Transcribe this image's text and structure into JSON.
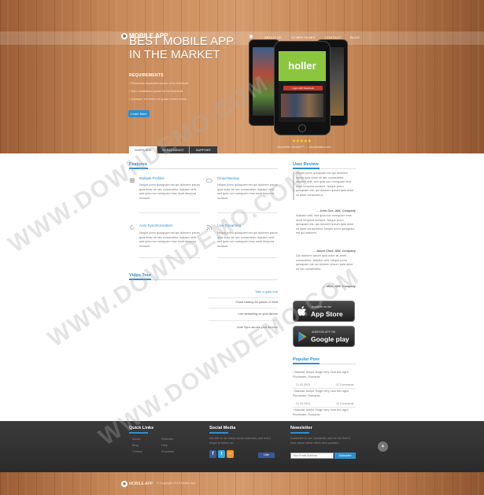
{
  "header": {
    "logo_text": "MOBILE APP",
    "nav": [
      "ABOUT US",
      "OTHER PAGES",
      "CONTACT",
      "BLOG"
    ]
  },
  "hero": {
    "title_line1": "BEST MOBILE APP",
    "title_line2": "IN THE MARKET",
    "requirements_heading": "REQUIREMENTS",
    "requirements": [
      "Phasellus imperdiet ipsum nunc tincidunt",
      "Sed vestibulum quam lorem tincidunt",
      "Quisque vel lorem ut quam ornare nunc"
    ],
    "learn_more": "Learn More",
    "phone_brand": "holler",
    "phone_button": "Login with Facebook",
    "rating": "★★★★★",
    "caption": "Abodeflex Mobile™ — Mobilelabs.com",
    "tabs": [
      "OVERVIEW",
      "SCREENSHOT",
      "SUPPORT"
    ]
  },
  "features": {
    "title": "Features",
    "items": [
      {
        "title": "Multiple Profiles",
        "text": "Neque porro quisquam est qui dolorem ipsum quia dolor sit nec consectetur, adipisci velit, sed quia non numquam eius modi tempora incidunt."
      },
      {
        "title": "Cloud Backup",
        "text": "Neque porro quisquam est qui dolorem ipsum quia dolor sit nec consectetur, adipisci velit, sed quia non numquam eius modi tempora incidunt."
      },
      {
        "title": "Auto Synchronization",
        "text": "Neque porro quisquam est qui dolorem ipsum quia dolor sit nec consectetur, adipisci velit, sed quia non numquam eius modi tempora incidunt."
      },
      {
        "title": "Live Streaming",
        "text": "Neque porro quisquam est qui dolorem ipsum quia dolor sit nec consectetur, adipisci velit, sed quia non numquam eius modi tempora incidunt."
      }
    ]
  },
  "video_tour": {
    "title": "Video Tour",
    "items": [
      "Take a quick tour",
      "Cloud backup for peace of mind",
      "Live streaming on your device",
      "Auto Sync across your devices"
    ]
  },
  "reviews": {
    "title": "User Review",
    "items": [
      {
        "text": "Neque porro quisquam est qui dolorem ipsum quia dolor sit nec consectetur, adipisci velit, sed quia non numquam eius modi tempora incidunt. Neque porro quisquam est, qui dolorem ipsum quia dolor sit amet consectetur.",
        "author": "— John Doe, ABC Company"
      },
      {
        "text": "Adipisci velit, sed quia non numquam eius modi tempora incidunt. Neque porro quisquam est, qui dolorem ipsum quia dolor sit amet consectetur. Neque porro quisquam est qui dolorem.",
        "author": "— Jason Clark, ABC Company"
      },
      {
        "text": "Qui dolorem ipsum quia dolor sit amet consectetur, adipisci velit. Neque porro quisquam est qui dolorem ipsum quia dolor sit nec consectetur.",
        "author": "— Mike, ABC Company"
      }
    ]
  },
  "stores": {
    "app_store_small": "Available on the",
    "app_store_big": "App Store",
    "google_play_small": "ANDROID APP ON",
    "google_play_big": "Google play"
  },
  "popular_posts": {
    "title": "Popular Post",
    "items": [
      {
        "text": "Bassiat, tempe fringe very near the night. Rochester, Romania",
        "date": "21.03.2013",
        "comments": "12 Comments"
      },
      {
        "text": "Bassiat, tempe fringe very near the night. Rochester, Romania",
        "date": "21.03.2013",
        "comments": "12 Comments"
      },
      {
        "text": "Bassiat, tempe fringe very near the night. Rochester, Romania",
        "date": "",
        "comments": ""
      }
    ]
  },
  "footer": {
    "quick_links_title": "Quick Links",
    "quick_links": [
      "About",
      "Blog",
      "Contact",
      "Features",
      "Help",
      "Purchase"
    ],
    "social_title": "Social Media",
    "social_text": "We are on so many social networks, you won't forget to follow us.",
    "social_icons": [
      "f",
      "t",
      "rss"
    ],
    "like_label": "Like",
    "newsletter_title": "Newsletter",
    "newsletter_text": "Subscribe to our newsletter and be the first to hear about latest offers and updates.",
    "email_placeholder": "Your Email Address",
    "subscribe_label": "Subscribe",
    "scroll_top": "▲"
  },
  "bottom": {
    "logo_text": "MOBILE APP",
    "copyright": "© Copyright 2013 Mobile App"
  },
  "watermarks": [
    "WWW.DOWNDEMO.COM",
    "WWW.DOWNDEMO.COM",
    "WWW.DOWNDEMO.COM"
  ],
  "colors": {
    "accent": "#2e8fd0",
    "footer": "#333333",
    "phone_brand": "#8cc63f"
  }
}
